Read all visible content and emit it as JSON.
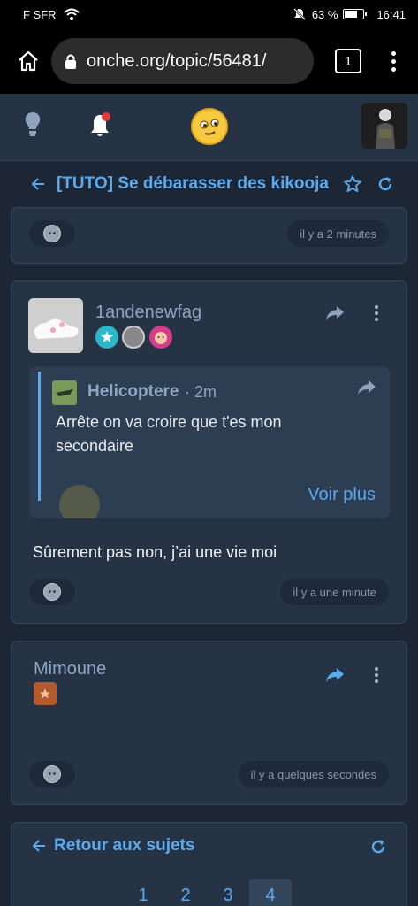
{
  "status_bar": {
    "carrier": "F SFR",
    "battery": "63 %",
    "battery_level": 0.63,
    "time": "16:41"
  },
  "browser": {
    "url": "onche.org/topic/56481/",
    "tab_count": "1"
  },
  "topic": {
    "title": "[TUTO] Se débarasser des kikooja"
  },
  "posts": [
    {
      "time": "il y a 2 minutes"
    },
    {
      "username": "1andenewfag",
      "quote": {
        "author": "Helicoptere",
        "time": "· 2m",
        "text": "Arrête on va croire que t'es mon secondaire",
        "more": "Voir plus"
      },
      "text": "Sûrement pas non, j’ai une vie moi",
      "time": "il y a une minute"
    },
    {
      "username": "Mimoune",
      "time": "il y a quelques secondes"
    }
  ],
  "footer": {
    "back_label": "Retour aux sujets",
    "pages": [
      "1",
      "2",
      "3",
      "4"
    ],
    "active_page": "4"
  },
  "colors": {
    "accent": "#5aaaf0",
    "background": "#1c2634",
    "card": "#253345",
    "notification": "#e53935"
  }
}
